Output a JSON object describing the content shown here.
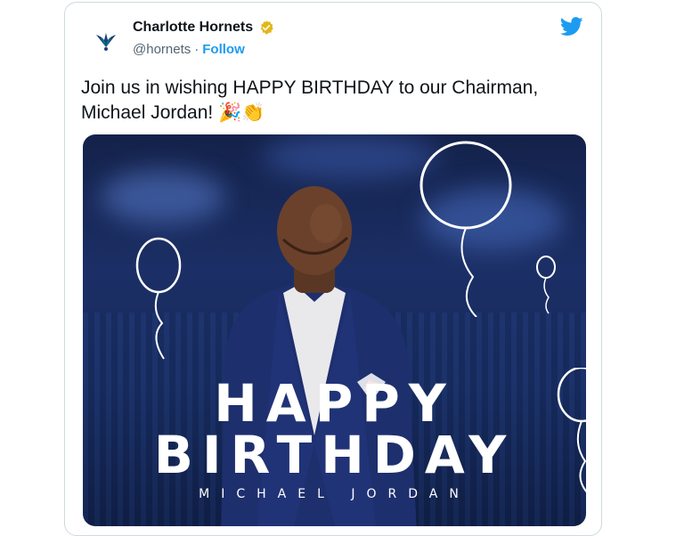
{
  "tweet": {
    "account_name": "Charlotte Hornets",
    "handle": "@hornets",
    "separator": "·",
    "follow_label": "Follow",
    "text": "Join us in wishing HAPPY BIRTHDAY to our Chairman, Michael Jordan! 🎉👏"
  },
  "media": {
    "headline_line1": "HAPPY",
    "headline_line2": "BIRTHDAY",
    "subtitle": "MICHAEL JORDAN"
  },
  "colors": {
    "accent_blue": "#1d9bf0",
    "verified_gold": "#e2b719",
    "text_primary": "#0f1419",
    "text_secondary": "#536471",
    "hornets_teal": "#1d3f7a"
  },
  "icons": {
    "avatar": "hornets-logo-icon",
    "verified": "verified-badge-icon",
    "brand": "twitter-bird-icon"
  }
}
